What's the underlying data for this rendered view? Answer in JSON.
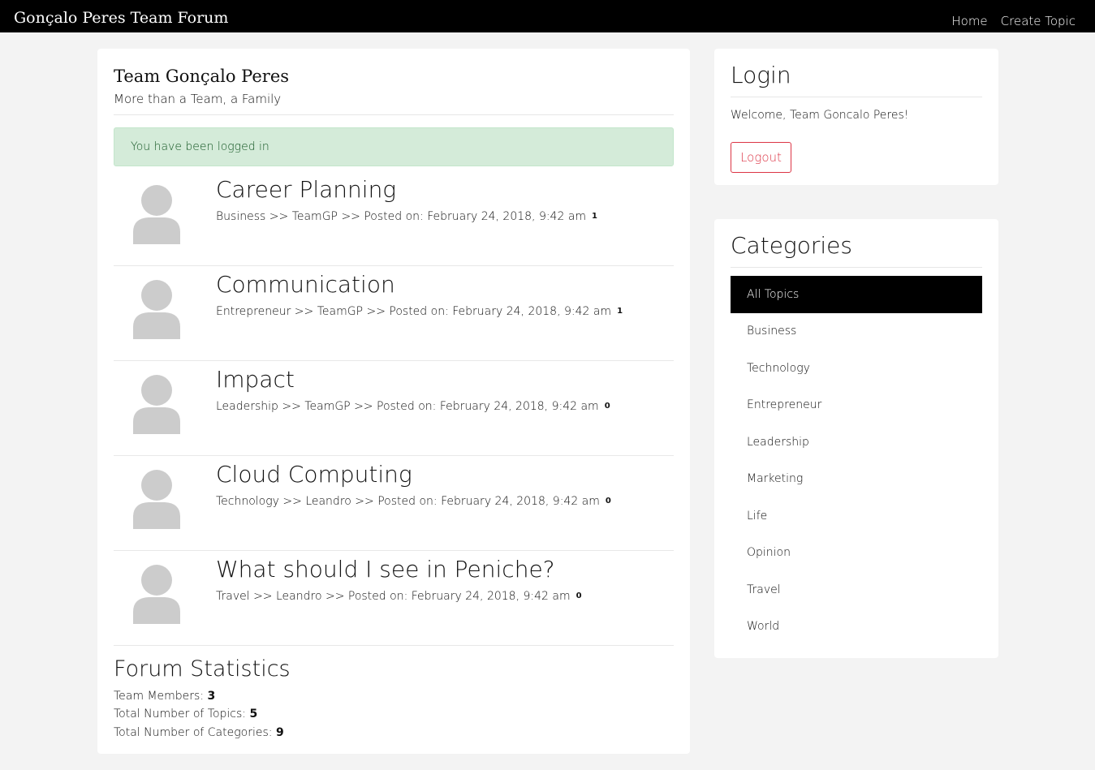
{
  "navbar": {
    "brand": "Gonçalo Peres Team Forum",
    "links": [
      "Home",
      "Create Topic"
    ]
  },
  "header": {
    "title": "Team Gonçalo Peres",
    "subtitle": "More than a Team, a Family"
  },
  "alert": {
    "message": "You have been logged in"
  },
  "topics": [
    {
      "title": "Career Planning",
      "category": "Business",
      "author": "TeamGP",
      "posted": "Posted on: February 24, 2018, 9:42 am",
      "replies": "1"
    },
    {
      "title": "Communication",
      "category": "Entrepreneur",
      "author": "TeamGP",
      "posted": "Posted on: February 24, 2018, 9:42 am",
      "replies": "1"
    },
    {
      "title": "Impact",
      "category": "Leadership",
      "author": "TeamGP",
      "posted": "Posted on: February 24, 2018, 9:42 am",
      "replies": "0"
    },
    {
      "title": "Cloud Computing",
      "category": "Technology",
      "author": "Leandro",
      "posted": "Posted on: February 24, 2018, 9:42 am",
      "replies": "0"
    },
    {
      "title": "What should I see in Peniche?",
      "category": "Travel",
      "author": "Leandro",
      "posted": "Posted on: February 24, 2018, 9:42 am",
      "replies": "0"
    }
  ],
  "separator": ">>",
  "stats": {
    "title": "Forum Statistics",
    "members_label": "Team Members:",
    "members": "3",
    "topics_label": "Total Number of Topics:",
    "topics": "5",
    "categories_label": "Total Number of Categories:",
    "categories": "9"
  },
  "login": {
    "title": "Login",
    "welcome": "Welcome, Team Goncalo Peres!",
    "logout_label": "Logout"
  },
  "categories": {
    "title": "Categories",
    "items": [
      "All Topics",
      "Business",
      "Technology",
      "Entrepreneur",
      "Leadership",
      "Marketing",
      "Life",
      "Opinion",
      "Travel",
      "World"
    ],
    "active": "All Topics"
  },
  "colors": {
    "navbar": "#000000",
    "alert_bg": "#d4ebd9",
    "alert_text": "#155724",
    "logout": "#dc3545",
    "avatar": "#cccccc"
  }
}
